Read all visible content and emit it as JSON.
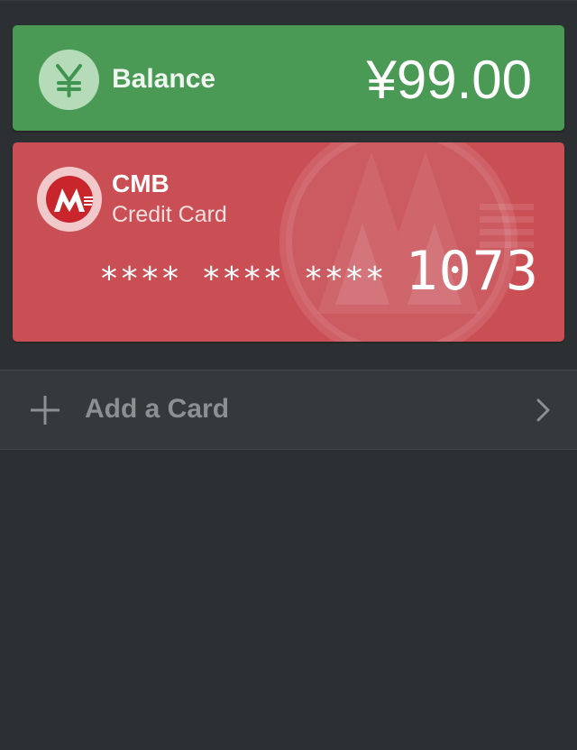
{
  "balance_card": {
    "label": "Balance",
    "amount": "¥99.00",
    "icon": "yen-icon",
    "color": "#4a9a56"
  },
  "credit_card": {
    "bank_name": "CMB",
    "card_type": "Credit Card",
    "masked_digits": "**** **** ****",
    "last_four": "1073",
    "logo": "cmb-bank-logo",
    "color": "#c94f55"
  },
  "add_card": {
    "label": "Add a Card",
    "icon": "plus-icon",
    "chevron": "chevron-right-icon"
  },
  "background_color": "#2d3032"
}
